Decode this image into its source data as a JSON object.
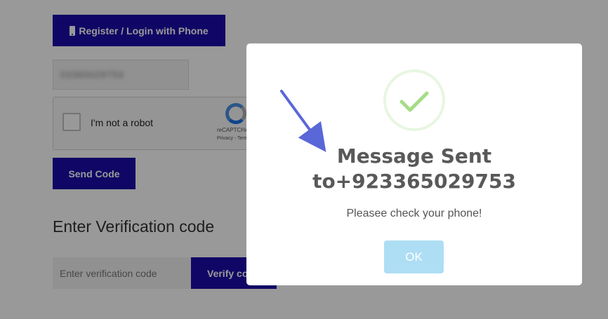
{
  "form": {
    "phone_button_label": "Register / Login with Phone",
    "phone_number_value": "03365029753",
    "recaptcha_label": "I'm not a robot",
    "recaptcha_brand": "reCAPTCHA",
    "recaptcha_terms": "Privacy - Terms",
    "send_code_label": "Send Code",
    "verification_heading": "Enter Verification code",
    "verification_placeholder": "Enter verification code",
    "verify_button_label": "Verify code"
  },
  "modal": {
    "icon": "checkmark-icon",
    "title_line1": "Message Sent",
    "title_line2": "to+923365029753",
    "message": "Pleasee check your phone!",
    "ok_label": "OK"
  },
  "colors": {
    "primary_button": "#1b0aa8",
    "overlay": "rgba(0,0,0,0.40)",
    "success_green": "#a5dc86",
    "ok_button": "#aedef4",
    "annotation_arrow": "#5a67d8"
  }
}
